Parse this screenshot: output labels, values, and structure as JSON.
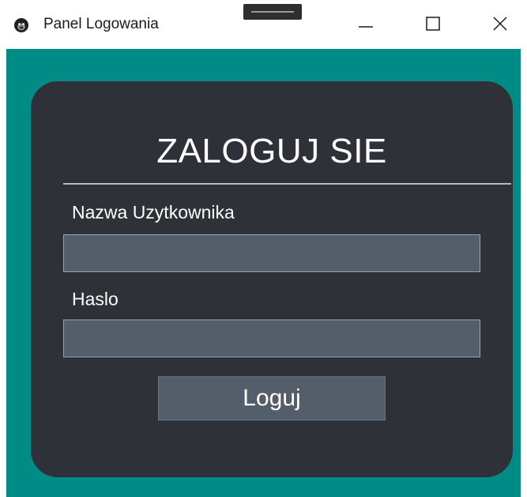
{
  "window": {
    "title": "Panel Logowania",
    "icon": "gorilla-icon"
  },
  "controls": {
    "minimize_icon": "minimize-icon",
    "maximize_icon": "maximize-icon",
    "close_icon": "close-icon"
  },
  "form": {
    "heading": "ZALOGUJ SIE",
    "username_label": "Nazwa Uzytkownika",
    "username_value": "",
    "password_label": "Haslo",
    "password_value": "",
    "submit_label": "Loguj"
  },
  "colors": {
    "background": "#008b87",
    "panel": "#2f3139",
    "input": "#545e6a",
    "text": "#ffffff"
  }
}
